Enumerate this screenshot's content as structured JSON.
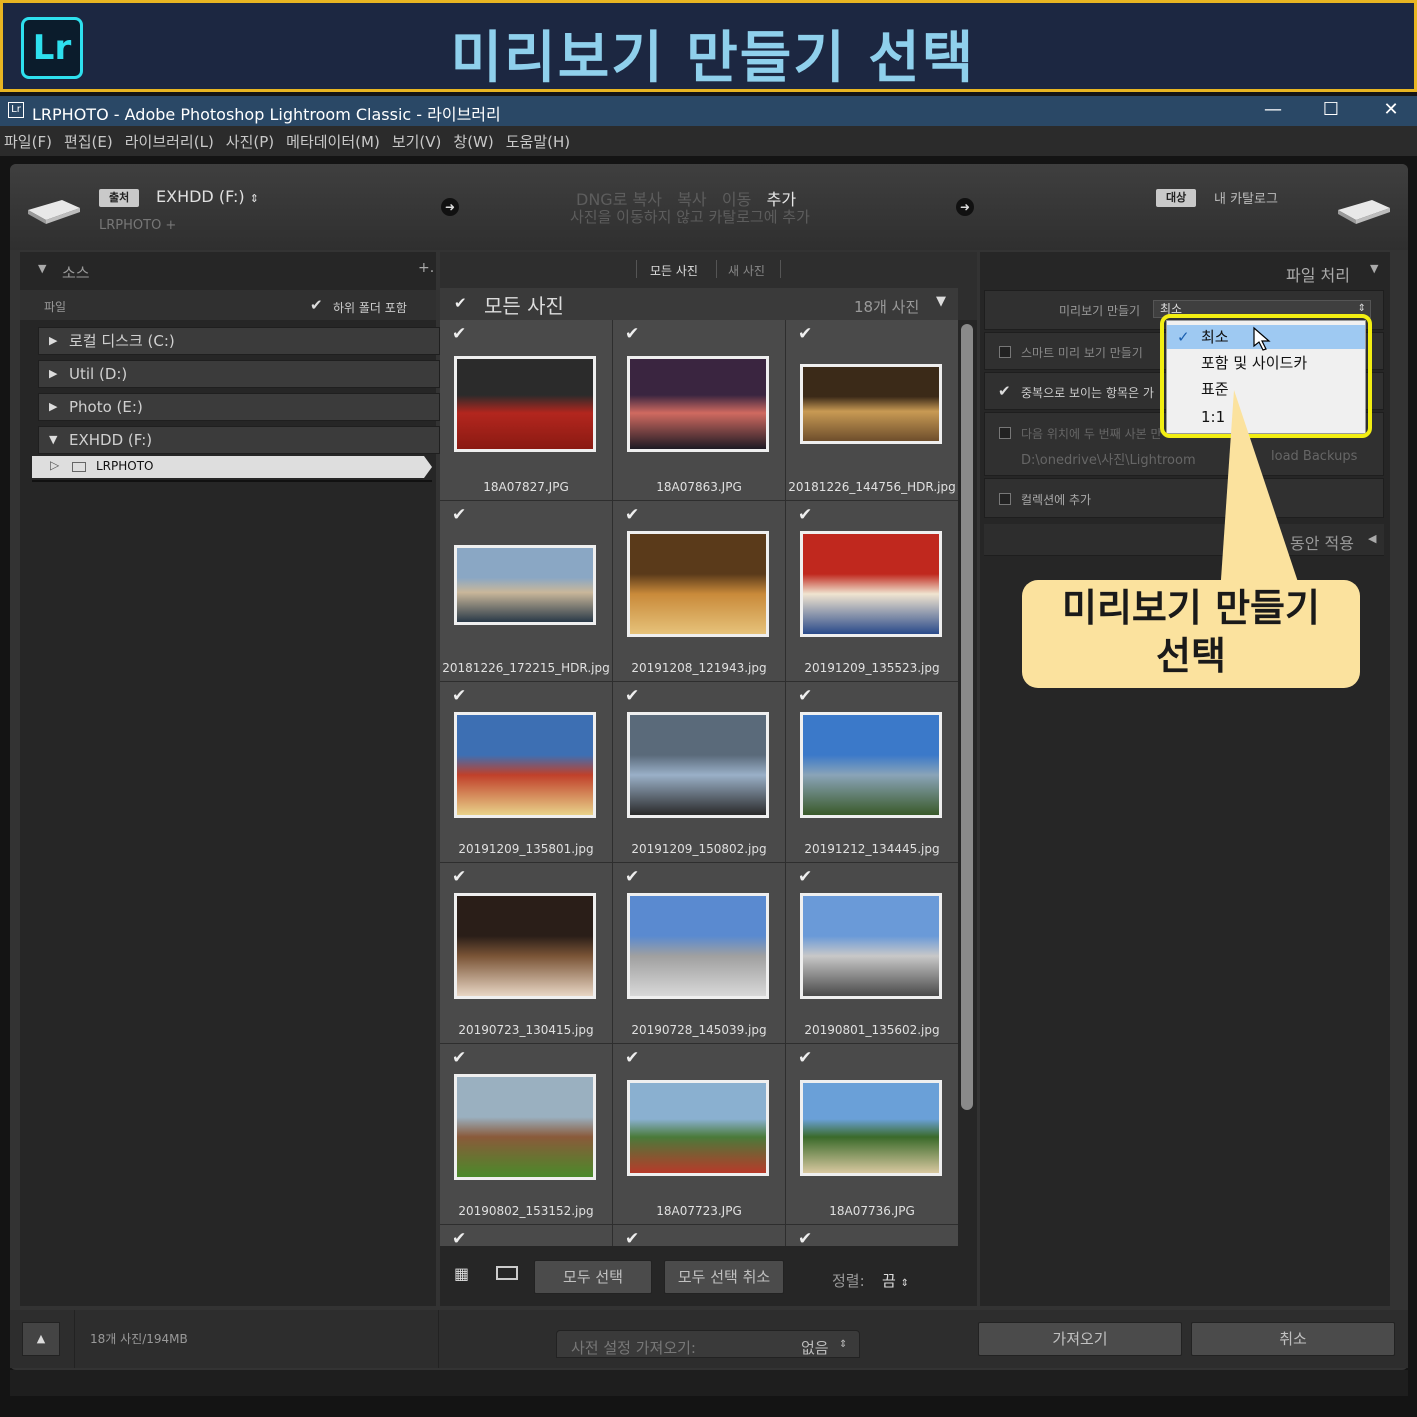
{
  "banner": {
    "logo": "Lr",
    "title": "미리보기 만들기 선택"
  },
  "window": {
    "app_icon": "Lr",
    "title": "LRPHOTO - Adobe Photoshop Lightroom Classic - 라이브러리",
    "minimize": "—",
    "maximize": "☐",
    "close": "✕"
  },
  "menu": [
    "파일(F)",
    "편집(E)",
    "라이브러리(L)",
    "사진(P)",
    "메타데이터(M)",
    "보기(V)",
    "창(W)",
    "도움말(H)"
  ],
  "header": {
    "source_tag": "출처",
    "source_drive": "EXHDD (F:)",
    "source_path": "LRPHOTO +",
    "modes": [
      "DNG로 복사",
      "복사",
      "이동",
      "추가"
    ],
    "mode_desc": "사진을 이동하지 않고 카탈로그에 추가",
    "dest_tag": "대상",
    "dest_name": "내 카탈로그"
  },
  "left_panel": {
    "title": "소스",
    "plus": "+.",
    "files_label": "파일",
    "include_subfolders": "하위 폴더 포함",
    "drives": [
      {
        "label": "로컬 디스크 (C:)",
        "tri": "▶"
      },
      {
        "label": "Util (D:)",
        "tri": "▶"
      },
      {
        "label": "Photo (E:)",
        "tri": "▶"
      },
      {
        "label": "EXHDD (F:)",
        "tri": "▼"
      }
    ],
    "folder": "LRPHOTO"
  },
  "center": {
    "tabs": [
      "모든 사진",
      "새 사진"
    ],
    "grid_title": "모든 사진",
    "count": "18개 사진",
    "photos": [
      "18A07827.JPG",
      "18A07863.JPG",
      "20181226_144756_HDR.jpg",
      "20181226_172215_HDR.jpg",
      "20191208_121943.jpg",
      "20191209_135523.jpg",
      "20191209_135801.jpg",
      "20191209_150802.jpg",
      "20191212_134445.jpg",
      "20190723_130415.jpg",
      "20190728_145039.jpg",
      "20190801_135602.jpg",
      "20190802_153152.jpg",
      "18A07723.JPG",
      "18A07736.JPG"
    ],
    "select_all": "모두 선택",
    "deselect_all": "모두 선택 취소",
    "sort_label": "정렬:",
    "sort_value": "끔"
  },
  "right_panel": {
    "title": "파일 처리",
    "build_previews_label": "미리보기 만들기",
    "build_previews_value": "최소",
    "smart_previews": "스마트 미리 보기 만들기",
    "no_duplicates": "중복으로 보이는 항목은 가",
    "second_copy": "다음 위치에 두 번째 사본 만",
    "second_copy_path": "D:\\onedrive\\사진\\Lightroom",
    "second_copy_path_tail": "load Backups",
    "add_collection": "컬렉션에 추가",
    "apply_during": "동안 적용",
    "dropdown_items": [
      "최소",
      "포함 및 사이드카",
      "표준",
      "1:1"
    ]
  },
  "callout": {
    "line1": "미리보기 만들기",
    "line2": "선택"
  },
  "footer": {
    "summary": "18개 사진/194MB",
    "preset_label": "사전 설정 가져오기:",
    "preset_value": "없음",
    "import": "가져오기",
    "cancel": "취소"
  }
}
